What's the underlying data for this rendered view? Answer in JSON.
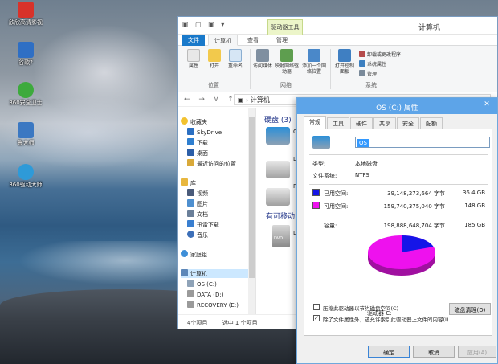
{
  "desktop": {
    "icons": [
      {
        "label": "欣欣高清影视"
      },
      {
        "label": "谷歌?"
      },
      {
        "label": "360安全卫士"
      },
      {
        "label": "鲁大师"
      },
      {
        "label": "360驱动大师"
      }
    ]
  },
  "explorer": {
    "title": "计算机",
    "context_tab": "驱动器工具",
    "quick_access": "▣ ▢ ▣ ▾",
    "tabs": {
      "file": "文件",
      "computer": "计算机",
      "view": "查看",
      "manage": "管理"
    },
    "ribbon": {
      "properties": "属性",
      "open": "打开",
      "rename": "重命名",
      "access_media": "访问媒体",
      "map_drive": "映射网络驱动器",
      "add_location": "添加一个网络位置",
      "open_control_panel": "打开控制面板",
      "uninstall": "卸载或更改程序",
      "system_properties": "系统属性",
      "manage": "管理",
      "group_location": "位置",
      "group_network": "网络",
      "group_system": "系统"
    },
    "nav_buttons": "← → ∨ ↑",
    "address": "计算机",
    "nav": {
      "favorites": "收藏夹",
      "skydrive": "SkyDrive",
      "downloads": "下载",
      "desktop": "桌面",
      "recent": "最近访问的位置",
      "libraries": "库",
      "videos": "视频",
      "pictures": "图片",
      "documents": "文档",
      "thunder": "迅雷下载",
      "music": "音乐",
      "homegroup": "家庭组",
      "computer": "计算机",
      "os": "OS (C:)",
      "data": "DATA (D:)",
      "recovery": "RECOVERY (E:)"
    },
    "content": {
      "group_disks": "硬盘 (3)",
      "group_removable": "有可移动",
      "drive1": "O",
      "drive2": "DA",
      "drive3": "RE",
      "drive4": "D",
      "dvd": "DVD"
    },
    "status": {
      "items": "4个项目",
      "selected": "选中 1 个项目"
    }
  },
  "dialog": {
    "title": "OS (C:) 属性",
    "close": "✕",
    "tabs": [
      "常规",
      "工具",
      "硬件",
      "共享",
      "安全",
      "配额"
    ],
    "name_value": "OS",
    "type_label": "类型:",
    "type_value": "本地磁盘",
    "fs_label": "文件系统:",
    "fs_value": "NTFS",
    "used_label": "已用空间:",
    "used_bytes": "39,148,273,664 字节",
    "used_gb": "36.4 GB",
    "free_label": "可用空间:",
    "free_bytes": "159,740,375,040 字节",
    "free_gb": "148 GB",
    "capacity_label": "容量:",
    "capacity_bytes": "198,888,648,704 字节",
    "capacity_gb": "185 GB",
    "drive_label": "驱动器 C:",
    "cleanup_button": "磁盘清理(D)",
    "compress_label": "压缩此驱动器以节约磁盘空间(C)",
    "index_label": "除了文件属性外，还允许索引此驱动器上文件的内容(I)",
    "ok": "确定",
    "cancel": "取消",
    "apply": "应用(A)",
    "colors": {
      "used": "#1515e8",
      "free": "#ee11ee"
    },
    "usage": {
      "used_fraction": 0.197,
      "free_fraction": 0.803
    }
  }
}
